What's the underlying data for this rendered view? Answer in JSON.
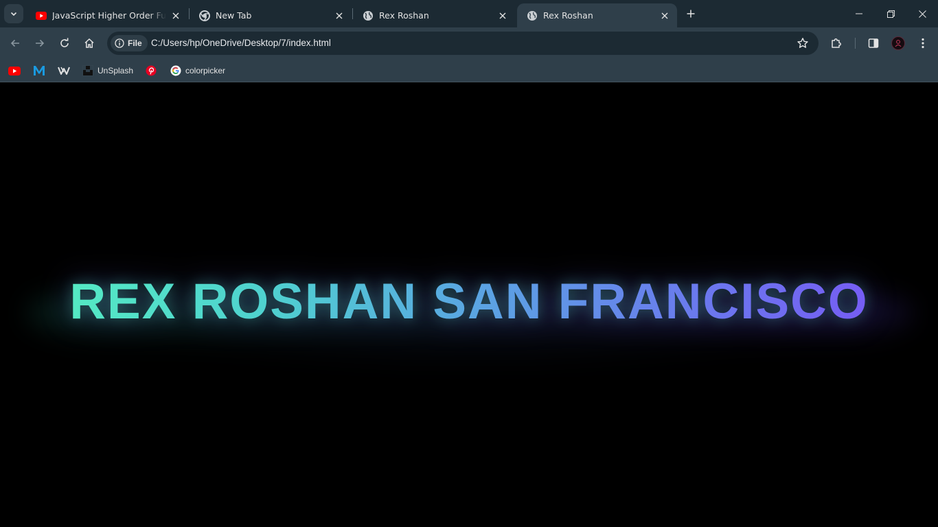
{
  "tabs": [
    {
      "title": "JavaScript Higher Order Functio",
      "icon": "youtube-icon",
      "active": false
    },
    {
      "title": "New Tab",
      "icon": "chrome-icon",
      "active": false
    },
    {
      "title": "Rex Roshan",
      "icon": "globe-icon",
      "active": false
    },
    {
      "title": "Rex Roshan",
      "icon": "globe-icon",
      "active": true
    }
  ],
  "address_bar": {
    "chip_label": "File",
    "url": "C:/Users/hp/OneDrive/Desktop/7/index.html"
  },
  "bookmarks": [
    {
      "label": "",
      "icon": "youtube-icon"
    },
    {
      "label": "",
      "icon": "medium-m-icon"
    },
    {
      "label": "",
      "icon": "webflow-icon"
    },
    {
      "label": "UnSplash",
      "icon": "unsplash-icon"
    },
    {
      "label": "",
      "icon": "pinterest-icon"
    },
    {
      "label": "colorpicker",
      "icon": "google-icon"
    }
  ],
  "page": {
    "heading": "REX ROSHAN SAN FRANCISCO",
    "gradient_colors": [
      "#56f2c0",
      "#5aa6e2",
      "#7a52f6"
    ]
  },
  "colors": {
    "tabstrip": "#1c2a33",
    "toolbar": "#2f3f4a",
    "page_bg": "#000000"
  }
}
